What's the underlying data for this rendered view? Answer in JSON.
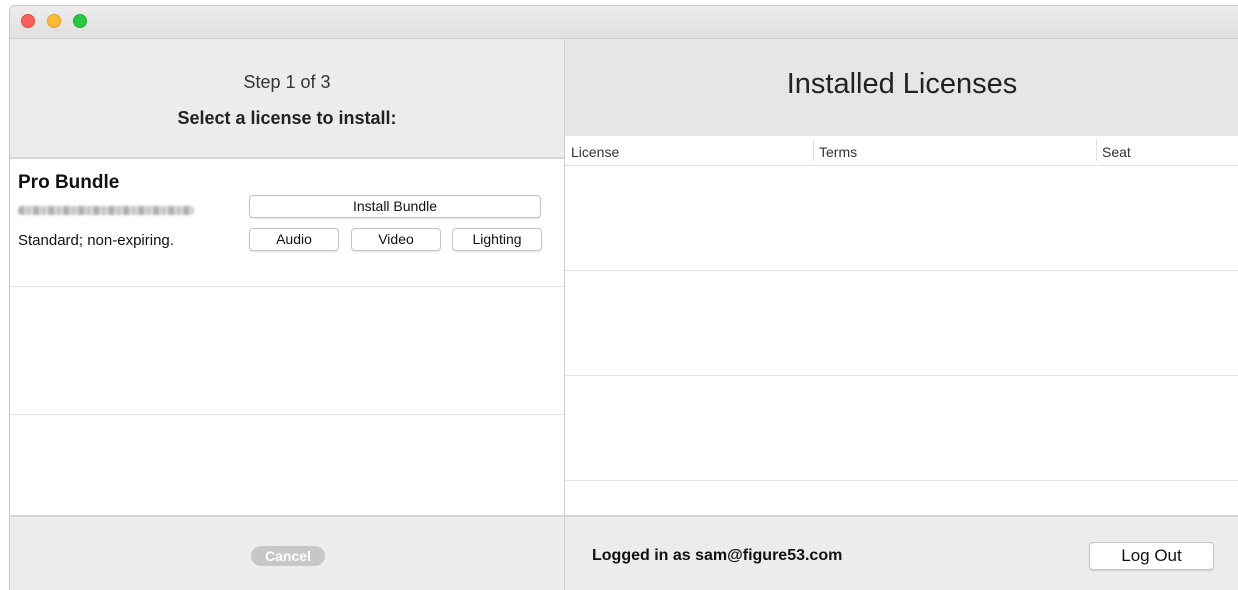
{
  "window": {
    "traffic_lights": [
      "close",
      "minimize",
      "zoom"
    ]
  },
  "wizard": {
    "step": "Step 1 of 3",
    "prompt": "Select a license to install:",
    "licenses": [
      {
        "name": "Pro Bundle",
        "terms": "Standard; non-expiring.",
        "install_label": "Install Bundle",
        "component_buttons": [
          "Audio",
          "Video",
          "Lighting"
        ]
      }
    ],
    "cancel_label": "Cancel"
  },
  "installed": {
    "title": "Installed Licenses",
    "columns": [
      "License",
      "Terms",
      "Seat"
    ],
    "rows": []
  },
  "account": {
    "status": "Logged in as sam@figure53.com",
    "logout_label": "Log Out"
  },
  "colors": {
    "close": "#fc5f57",
    "minimize": "#fdbc2e",
    "zoom": "#28c840",
    "panel_bg": "#ececec",
    "disabled_button": "#c7c7c7"
  }
}
